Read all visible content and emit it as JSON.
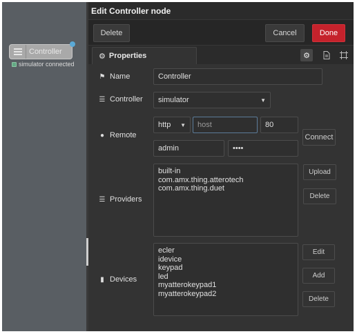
{
  "canvas": {
    "node_label": "Controller",
    "status_text": "simulator connected"
  },
  "editor": {
    "title": "Edit Controller node",
    "toolbar": {
      "delete_label": "Delete",
      "cancel_label": "Cancel",
      "done_label": "Done"
    },
    "tabs": {
      "properties_label": "Properties",
      "icons": [
        "gear-icon",
        "document-icon",
        "frame-icon"
      ]
    },
    "form": {
      "name": {
        "label": "Name",
        "value": "Controller"
      },
      "controller": {
        "label": "Controller",
        "selected": "simulator"
      },
      "remote": {
        "label": "Remote",
        "protocol": "http",
        "host_placeholder": "host",
        "port": "80",
        "username": "admin",
        "password_mask": "••••",
        "connect_label": "Connect"
      },
      "providers": {
        "label": "Providers",
        "items": [
          "built-in",
          "com.amx.thing.atterotech",
          "com.amx.thing.duet"
        ],
        "upload_label": "Upload",
        "delete_label": "Delete"
      },
      "devices": {
        "label": "Devices",
        "items": [
          "ecler",
          "idevice",
          "keypad",
          "led",
          "myatterokeypad1",
          "myatterokeypad2"
        ],
        "edit_label": "Edit",
        "add_label": "Add",
        "delete_label": "Delete"
      }
    }
  },
  "colors": {
    "done_button": "#c5222c",
    "panel": "#333333",
    "canvas": "#595e63",
    "status_green": "#63a984",
    "port_blue": "#5aa9d6"
  }
}
